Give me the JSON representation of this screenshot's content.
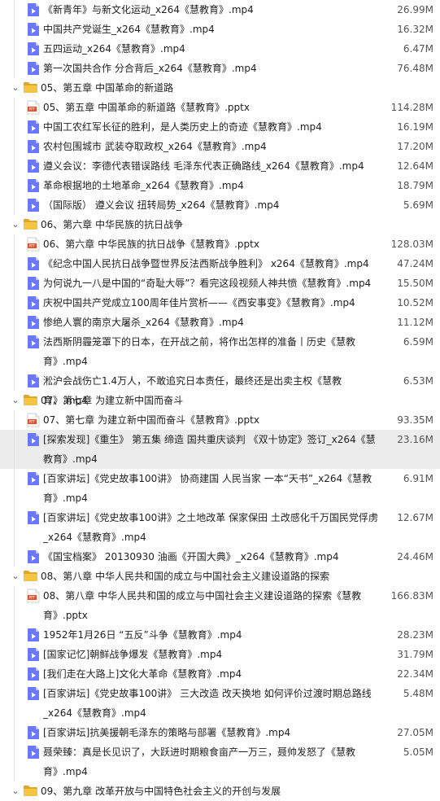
{
  "rows": [
    {
      "type": "file",
      "kind": "mp4",
      "name": "《新青年》与新文化运动_x264《慧教育》.mp4",
      "size": "26.99M"
    },
    {
      "type": "file",
      "kind": "mp4",
      "name": "中国共产党诞生_x264《慧教育》.mp4",
      "size": "16.32M"
    },
    {
      "type": "file",
      "kind": "mp4",
      "name": "五四运动_x264《慧教育》.mp4",
      "size": "6.47M"
    },
    {
      "type": "file",
      "kind": "mp4",
      "name": "第一次国共合作 分合背后_x264《慧教育》.mp4",
      "size": "76.48M"
    },
    {
      "type": "folder",
      "name": "05、第五章 中国革命的新道路"
    },
    {
      "type": "file",
      "kind": "pptx",
      "name": "05、第五章 中国革命的新道路《慧教育》.pptx",
      "size": "114.28M"
    },
    {
      "type": "file",
      "kind": "mp4",
      "name": "中国工农红军长征的胜利，是人类历史上的奇迹《慧教育》.mp4",
      "size": "16.19M"
    },
    {
      "type": "file",
      "kind": "mp4",
      "name": "农村包围城市 武装夺取政权_x264《慧教育》.mp4",
      "size": "17.20M"
    },
    {
      "type": "file",
      "kind": "mp4",
      "name": "遵义会议：李德代表错误路线 毛泽东代表正确路线_x264《慧教育》.mp4",
      "size": "12.64M"
    },
    {
      "type": "file",
      "kind": "mp4",
      "name": "革命根据地的土地革命_x264《慧教育》.mp4",
      "size": "18.79M"
    },
    {
      "type": "file",
      "kind": "mp4",
      "name": "（国际版） 遵义会议 扭转局势_x264《慧教育》.mp4",
      "size": "5.69M"
    },
    {
      "type": "folder",
      "name": "06、第六章 中华民族的抗日战争"
    },
    {
      "type": "file",
      "kind": "pptx",
      "name": "06、第六章 中华民族的抗日战争《慧教育》.pptx",
      "size": "128.03M"
    },
    {
      "type": "file",
      "kind": "mp4",
      "name": "《纪念中国人民抗日战争暨世界反法西斯战争胜利》 x264《慧教育》.mp4",
      "size": "47.24M"
    },
    {
      "type": "file",
      "kind": "mp4",
      "name": "为何说九一八是中国的“奇耻大辱”？看完这段视频人神共愤《慧教育》.mp4",
      "size": "15.50M"
    },
    {
      "type": "file",
      "kind": "mp4",
      "name": "庆祝中国共产党成立100周年佳片赏析——《西安事变》《慧教育》.mp4",
      "size": "10.52M"
    },
    {
      "type": "file",
      "kind": "mp4",
      "name": "惨绝人寰的南京大屠杀_x264《慧教育》.mp4",
      "size": "11.12M"
    },
    {
      "type": "file",
      "kind": "mp4",
      "name": "法西斯阴霾笼罩下的日本，在开战之前，将作出怎样的准备丨历史《慧教育》.mp4",
      "size": "6.59M",
      "lines": 2
    },
    {
      "type": "file",
      "kind": "mp4",
      "name": "淞沪会战伤亡1.4万人，不敢追究日本责任，最终还是出卖主权《慧教育》.mp4",
      "size": "6.53M"
    },
    {
      "type": "folder",
      "name": "07、第七章 为建立新中国而奋斗"
    },
    {
      "type": "file",
      "kind": "pptx",
      "name": "07、第七章 为建立新中国而奋斗《慧教育》.pptx",
      "size": "93.35M"
    },
    {
      "type": "file",
      "kind": "mp4",
      "name": "[探索发现]《重生》 第五集 缔造 国共重庆谈判 《双十协定》签订_x264《慧教育》.mp4",
      "size": "23.16M",
      "lines": 2,
      "selected": true
    },
    {
      "type": "file",
      "kind": "mp4",
      "name": "[百家讲坛]《党史故事100讲》 协商建国 人民当家 一本“天书”_x264《慧教育》.mp4",
      "size": "6.91M",
      "lines": 2
    },
    {
      "type": "file",
      "kind": "mp4",
      "name": "[百家讲坛]《党史故事100讲》之土地改革 保家保田 土改感化千万国民党俘虏_x264《慧教育》.mp4",
      "size": "12.67M",
      "lines": 2
    },
    {
      "type": "file",
      "kind": "mp4",
      "name": "《国宝档案》 20130930 油画《开国大典》_x264《慧教育》.mp4",
      "size": "24.46M"
    },
    {
      "type": "folder",
      "name": "08、第八章 中华人民共和国的成立与中国社会主义建设道路的探索"
    },
    {
      "type": "file",
      "kind": "pptx",
      "name": "08、第八章 中华人民共和国的成立与中国社会主义建设道路的探索《慧教育》.pptx",
      "size": "166.83M",
      "lines": 2
    },
    {
      "type": "file",
      "kind": "mp4",
      "name": "1952年1月26日 “五反”斗争《慧教育》.mp4",
      "size": "28.23M"
    },
    {
      "type": "file",
      "kind": "mp4",
      "name": "[国家记忆]朝鲜战争爆发《慧教育》.mp4",
      "size": "31.79M"
    },
    {
      "type": "file",
      "kind": "mp4",
      "name": "[我们走在大路上]文化大革命《慧教育》.mp4",
      "size": "22.34M"
    },
    {
      "type": "file",
      "kind": "mp4",
      "name": "[百家讲坛]《党史故事100讲》 三大改造 改天换地 如何评价过渡时期总路线_x264《慧教育》.mp4",
      "size": "5.48M",
      "lines": 2
    },
    {
      "type": "file",
      "kind": "mp4",
      "name": "[百家讲坛]抗美援朝毛泽东的策略与部署《慧教育》.mp4",
      "size": "27.05M"
    },
    {
      "type": "file",
      "kind": "mp4",
      "name": "聂荣臻：真是长见识了，大跃进时期粮食亩产一万三，聂帅发怒了《慧教育》.mp4",
      "size": "5.05M",
      "lines": 2
    },
    {
      "type": "folder",
      "name": "09、第九章 改革开放与中国特色社会主义的开创与发展"
    }
  ],
  "colors": {
    "folder": "#f5c242",
    "folder_dark": "#e0a72a",
    "video": "#6a78ff",
    "pptx": "#e3502e",
    "selected": "#ececec"
  },
  "icons": {
    "mp4": "video-file-icon",
    "pptx": "pptx-file-icon",
    "folder": "folder-icon",
    "chevron": "chevron-down-icon"
  }
}
